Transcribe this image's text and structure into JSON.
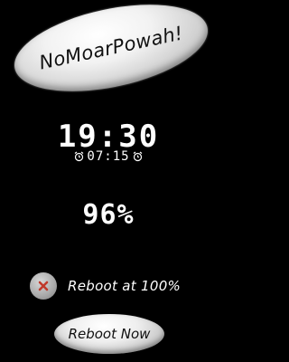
{
  "app": {
    "logo_text": "NoMoarPowah!"
  },
  "clock": {
    "time": "19:30",
    "alarm_time": "07:15"
  },
  "battery": {
    "percent": "96%"
  },
  "reboot_option": {
    "label": "Reboot at 100%",
    "checked": false
  },
  "actions": {
    "reboot_now_label": "Reboot Now"
  },
  "colors": {
    "background": "#000000",
    "text": "#ffffff",
    "button": "#e6e6e6",
    "checkbox_x": "#c0392b"
  }
}
